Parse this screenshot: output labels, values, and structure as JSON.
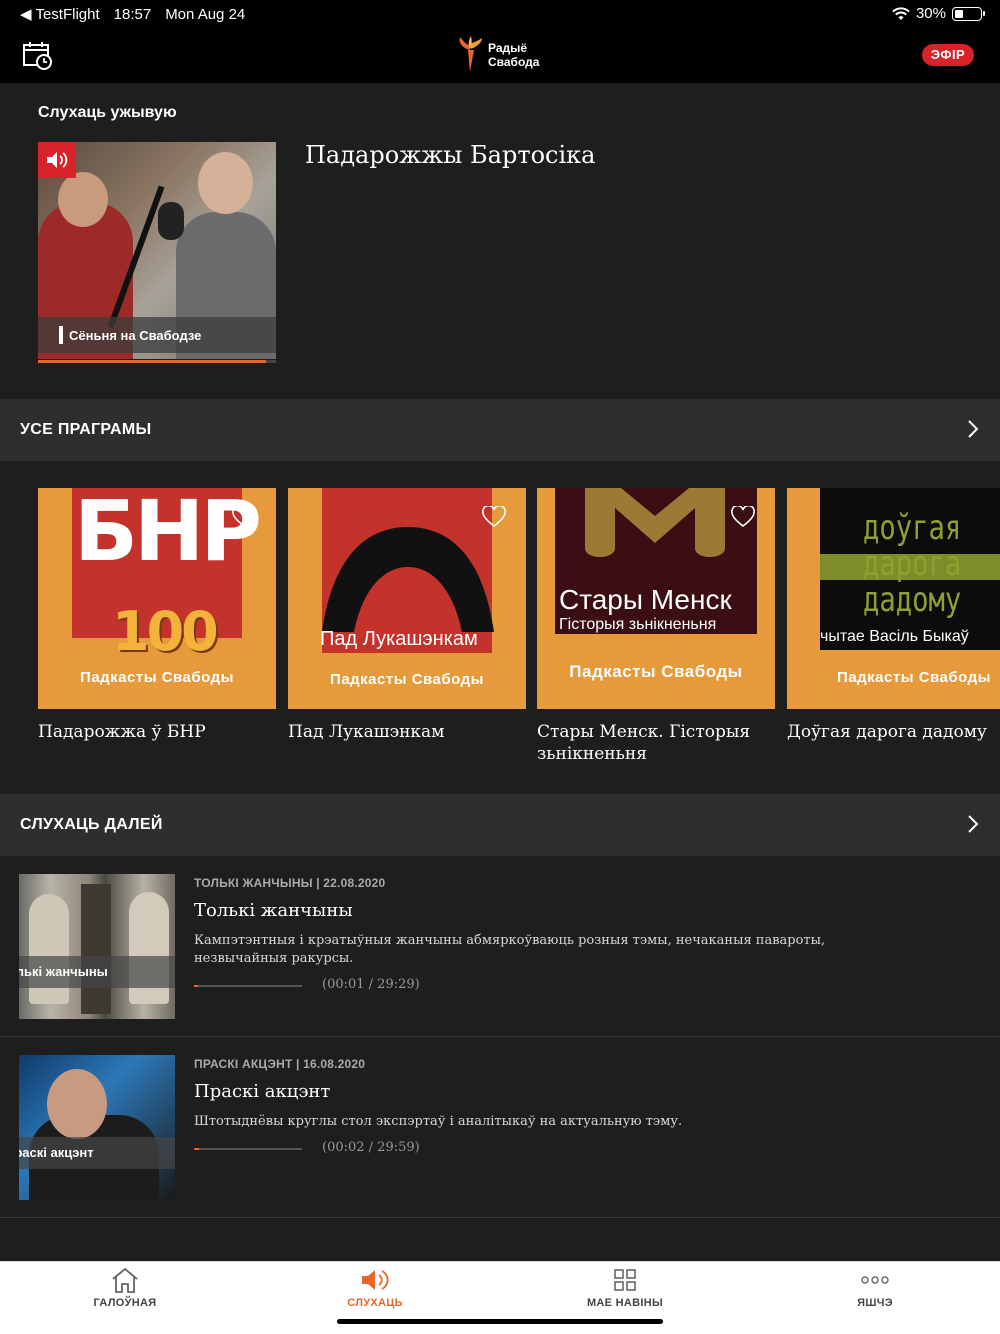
{
  "status": {
    "back_app": "TestFlight",
    "time": "18:57",
    "date": "Mon Aug 24",
    "battery": "30%",
    "battery_level": 0.3
  },
  "nav": {
    "logo_line1": "Радыё",
    "logo_line2": "Свабода",
    "live_label": "ЭФІР"
  },
  "now_playing": {
    "heading": "Слухаць ужывую",
    "thumb_label": "Сёньня на Свабодзе",
    "title": "Падарожжы Бартосіка",
    "progress": 0.96
  },
  "programs_section": {
    "title": "УСЕ ПРАГРАМЫ",
    "brand": "Падкасты Свабоды",
    "items": [
      {
        "name": "Падарожжа ў БНР",
        "art_text1": "БНР",
        "art_text2": "100"
      },
      {
        "name": "Пад Лукашэнкам",
        "art_text1": "Пад Лукашэнкам"
      },
      {
        "name": "Стары Менск. Гісторыя зьнікненьня",
        "art_text1": "Стары Менск",
        "art_text2": "Гісторыя зьнікненьня"
      },
      {
        "name": "Доўгая дарога дадому",
        "art_text1": "доўгая",
        "art_text2": "дарога",
        "art_text3": "дадому",
        "art_text4": "чытае Васіль Быкаў"
      }
    ]
  },
  "continue_section": {
    "title": "СЛУХАЦЬ ДАЛЕЙ",
    "episodes": [
      {
        "meta": "ТОЛЬКІ ЖАНЧЫНЫ | 22.08.2020",
        "title": "Толькі жанчыны",
        "description": "Кампэтэнтныя і крэатыўныя жанчыны абмяркоўваюць розныя тэмы, нечаканыя павароты, незвычайныя ракурсы.",
        "time": "(00:01 / 29:29)",
        "thumb_label": "Толькі жанчыны",
        "progress": 0.04
      },
      {
        "meta": "ПРАСКІ АКЦЭНТ | 16.08.2020",
        "title": "Праскі акцэнт",
        "description": "Штотыднёвы круглы стол экспэртаў і аналітыкаў на актуальную тэму.",
        "time": "(00:02 / 29:59)",
        "thumb_label": "Праскі акцэнт",
        "progress": 0.05
      }
    ]
  },
  "tabs": [
    {
      "label": "ГАЛОЎНАЯ",
      "icon": "home-icon"
    },
    {
      "label": "СЛУХАЦЬ",
      "icon": "speaker-icon"
    },
    {
      "label": "МАЕ НАВІНЫ",
      "icon": "grid-icon"
    },
    {
      "label": "ЯШЧЭ",
      "icon": "more-icon"
    }
  ],
  "colors": {
    "accent": "#e8662b",
    "live": "#d8232a",
    "background": "#1e1e1e",
    "section_header": "#2e2e2e"
  }
}
